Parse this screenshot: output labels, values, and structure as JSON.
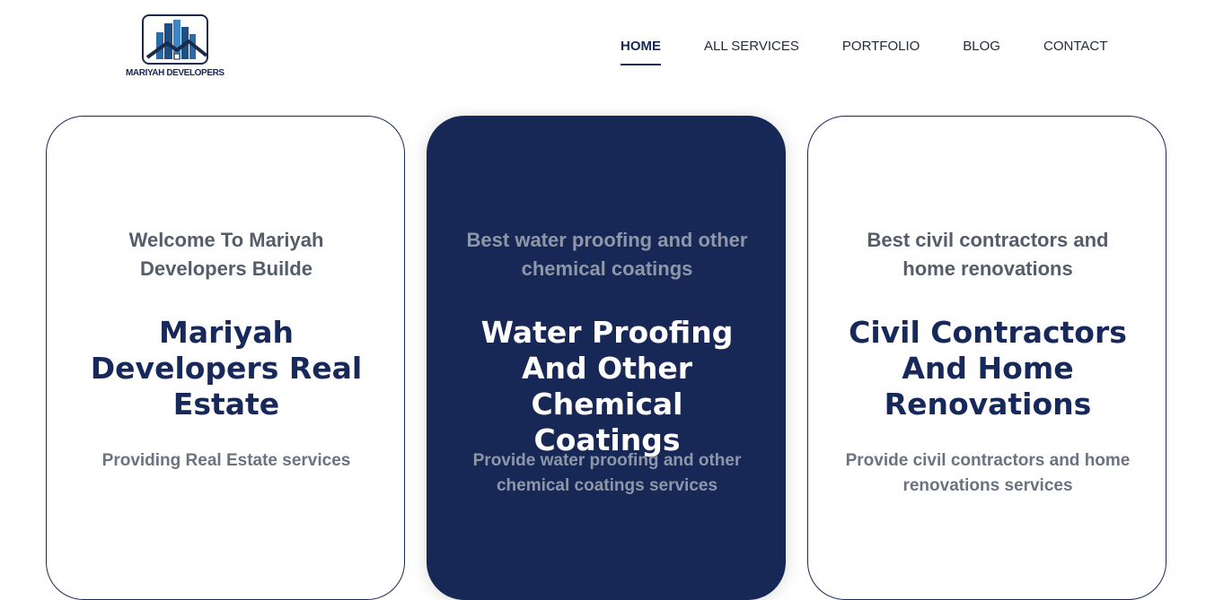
{
  "header": {
    "logo_text": "MARIYAH DEVELOPERS",
    "nav": [
      {
        "label": "HOME",
        "active": true
      },
      {
        "label": "ALL SERVICES",
        "active": false
      },
      {
        "label": "PORTFOLIO",
        "active": false
      },
      {
        "label": "BLOG",
        "active": false
      },
      {
        "label": "CONTACT",
        "active": false
      }
    ]
  },
  "cards": [
    {
      "subtitle": "Welcome To Mariyah Developers Builde",
      "title": "Mariyah Developers Real Estate",
      "description": "Providing Real Estate services"
    },
    {
      "subtitle": "Best water proofing and other chemical coatings",
      "title": "Water Proofing And Other Chemical Coatings",
      "description": "Provide water proofing and other chemical coatings services"
    },
    {
      "subtitle": "Best civil contractors and home renovations",
      "title": "Civil Contractors And Home Renovations",
      "description": "Provide civil contractors and home renovations services"
    }
  ],
  "colors": {
    "brand_navy": "#172856",
    "text_gray": "#555d6b",
    "desc_gray": "#6b7280"
  }
}
